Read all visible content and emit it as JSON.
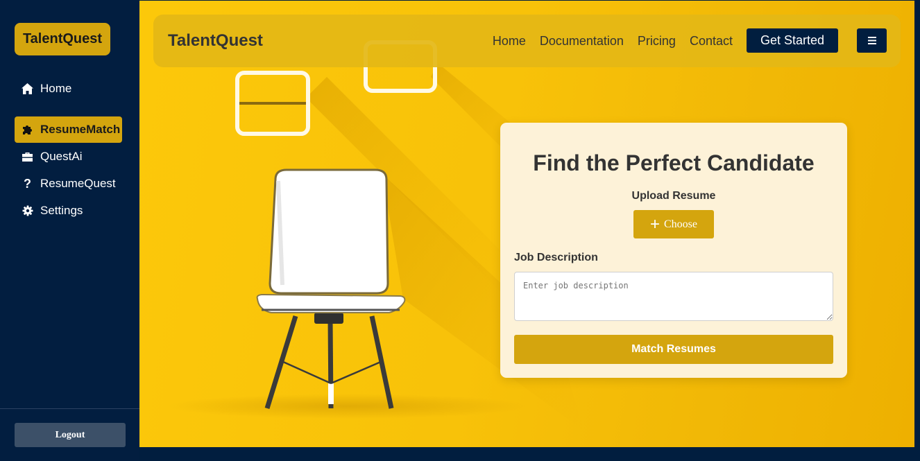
{
  "sidebar": {
    "brand": "TalentQuest",
    "items": [
      {
        "label": "Home",
        "icon": "home-icon"
      },
      {
        "label": "ResumeMatch",
        "icon": "puzzle-icon",
        "active": true
      },
      {
        "label": "QuestAi",
        "icon": "briefcase-icon"
      },
      {
        "label": "ResumeQuest",
        "icon": "question-icon"
      },
      {
        "label": "Settings",
        "icon": "gear-icon"
      }
    ],
    "logout_label": "Logout"
  },
  "topbar": {
    "brand": "TalentQuest",
    "nav": [
      "Home",
      "Documentation",
      "Pricing",
      "Contact"
    ],
    "cta_label": "Get Started",
    "menu_icon": "hamburger-icon"
  },
  "card": {
    "title": "Find the Perfect Candidate",
    "upload_label": "Upload Resume",
    "choose_label": "Choose",
    "jd_label": "Job Description",
    "jd_placeholder": "Enter job description",
    "jd_value": "",
    "submit_label": "Match Resumes"
  },
  "colors": {
    "sidebar_bg": "#021e40",
    "accent": "#d4a50e",
    "hero_yellow": "#fcc80a",
    "card_bg": "#fdf2d8",
    "navy_button": "#011e3f"
  }
}
